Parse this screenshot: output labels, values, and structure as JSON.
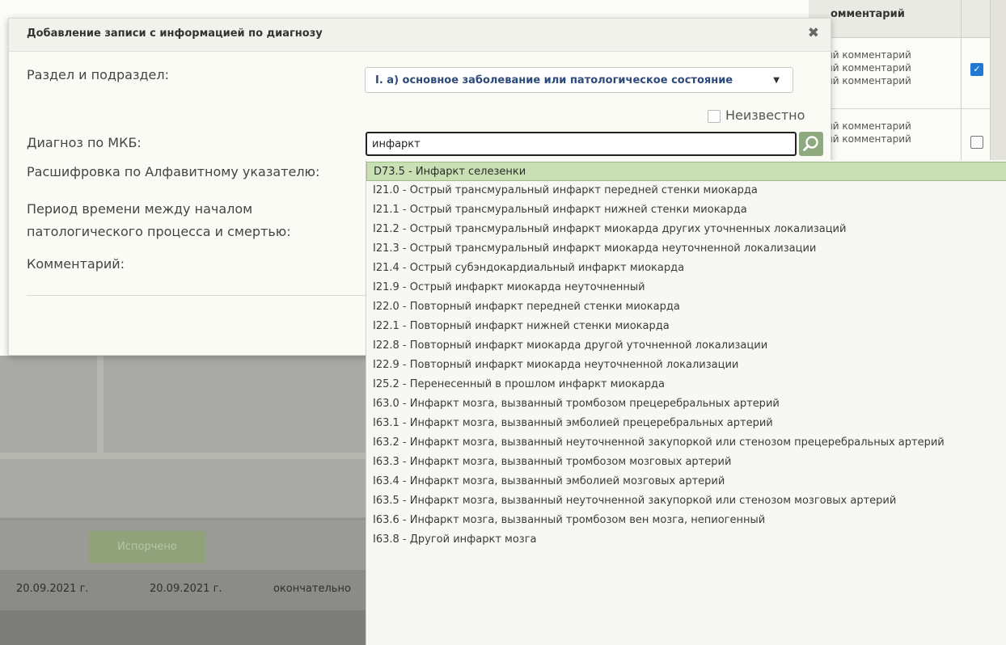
{
  "background": {
    "comment_header": "омментарий",
    "comment_rows": [
      [
        "тарий комментарий",
        "тарий комментарий",
        "тарий комментарий"
      ],
      [
        "тарий комментарий",
        "тарий комментарий"
      ]
    ],
    "row_checked": [
      true,
      false
    ],
    "spoiled_button": "Испорчено",
    "dates": [
      "20.09.2021 г.",
      "20.09.2021 г.",
      "окончательно"
    ]
  },
  "modal": {
    "title": "Добавление записи с информацией по диагнозу",
    "close_icon": "close-icon",
    "labels": {
      "section": "Раздел и подраздел:",
      "diagnosis": "Диагноз по МКБ:",
      "decoding": "Расшифровка по Алфавитному указателю:",
      "period_line1": "Период времени между началом",
      "period_line2": "патологического процесса и смертью:",
      "comment": "Комментарий:"
    },
    "section_value": "I. а) основное заболевание или патологическое состояние",
    "unknown_label": "Неизвестно",
    "unknown_checked": false,
    "search_value": "инфаркт",
    "search_icon": "search-icon"
  },
  "dropdown": {
    "selected_index": 0,
    "items": [
      "D73.5 - Инфаркт селезенки",
      "I21.0 - Острый трансмуральный инфаркт передней стенки миокарда",
      "I21.1 - Острый трансмуральный инфаркт нижней стенки миокарда",
      "I21.2 - Острый трансмуральный инфаркт миокарда других уточненных локализаций",
      "I21.3 - Острый трансмуральный инфаркт миокарда неуточненной локализации",
      "I21.4 - Острый субэндокардиальный инфаркт миокарда",
      "I21.9 - Острый инфаркт миокарда неуточненный",
      "I22.0 - Повторный инфаркт передней стенки миокарда",
      "I22.1 - Повторный инфаркт нижней стенки миокарда",
      "I22.8 - Повторный инфаркт миокарда другой уточненной локализации",
      "I22.9 - Повторный инфаркт миокарда неуточненной локализации",
      "I25.2 - Перенесенный в прошлом инфаркт миокарда",
      "I63.0 - Инфаркт мозга, вызванный тромбозом прецеребральных артерий",
      "I63.1 - Инфаркт мозга, вызванный эмболией прецеребральных артерий",
      "I63.2 - Инфаркт мозга, вызванный неуточненной закупоркой или стенозом прецеребральных артерий",
      "I63.3 - Инфаркт мозга, вызванный тромбозом мозговых артерий",
      "I63.4 - Инфаркт мозга, вызванный эмболией мозговых артерий",
      "I63.5 - Инфаркт мозга, вызванный неуточненной закупоркой или стенозом мозговых артерий",
      "I63.6 - Инфаркт мозга, вызванный тромбозом вен мозга, непиогенный",
      "I63.8 - Другой инфаркт мозга"
    ]
  },
  "colors": {
    "selected_item_bg": "#c9dfb4",
    "search_button": "#8fa97f",
    "checkbox_checked": "#1f78d1"
  }
}
